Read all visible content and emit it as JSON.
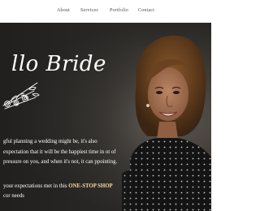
{
  "nav": {
    "items": [
      {
        "label": "About"
      },
      {
        "label": "Services"
      },
      {
        "label": "Portfolio"
      },
      {
        "label": "Contact"
      }
    ]
  },
  "hero": {
    "brand": "llo Bride",
    "paragraph": "gful planning a wedding might be, it's also expectation that it will be the happiest time in ot of pressure on you, and when it's not, it can ppointing.",
    "tagline_pre": "your expectations met in this ",
    "tagline_highlight": "ONE-STOP SHOP",
    "tagline_post": "cor needs"
  },
  "colors": {
    "nav_text": "#4e4e4e",
    "hero_bg": "#2b2927",
    "highlight": "#f7d7a0"
  }
}
